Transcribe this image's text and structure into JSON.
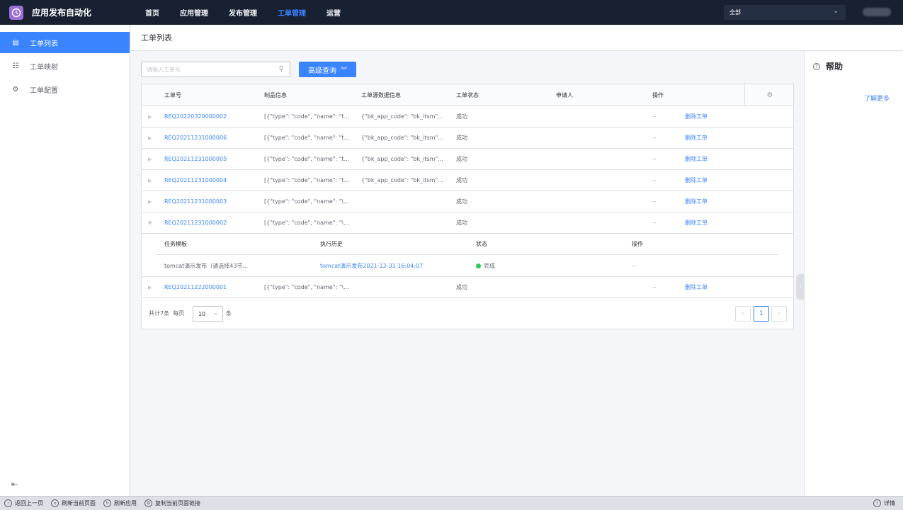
{
  "app": {
    "title": "应用发布自动化",
    "logo_icon": "clock-icon"
  },
  "topnav": {
    "items": [
      {
        "label": "首页",
        "active": false
      },
      {
        "label": "应用管理",
        "active": false
      },
      {
        "label": "发布管理",
        "active": false
      },
      {
        "label": "工单管理",
        "active": true
      },
      {
        "label": "运营",
        "active": false
      }
    ],
    "business_select": "全部"
  },
  "sidebar": {
    "items": [
      {
        "label": "工单列表",
        "icon": "list-icon",
        "active": true
      },
      {
        "label": "工单映射",
        "icon": "grid-icon",
        "active": false
      },
      {
        "label": "工单配置",
        "icon": "gear-icon",
        "active": false
      }
    ]
  },
  "page": {
    "title": "工单列表"
  },
  "search": {
    "placeholder": "请输入工单号",
    "advanced_label": "高级查询"
  },
  "table": {
    "columns": {
      "no": "工单号",
      "product": "制品信息",
      "source": "工单源数据信息",
      "status": "工单状态",
      "applicant": "申请人",
      "ops": "操作"
    },
    "rows": [
      {
        "no": "REQ20220320000002",
        "product": "[{\"type\": \"code\", \"name\": \"t...",
        "source": "{\"bk_app_code\": \"bk_itsm\"...",
        "status": "成功",
        "applicant": "",
        "ops": "--",
        "action": "删除工单"
      },
      {
        "no": "REQ20211231000006",
        "product": "[{\"type\": \"code\", \"name\": \"t...",
        "source": "{\"bk_app_code\": \"bk_itsm\"...",
        "status": "成功",
        "applicant": "",
        "ops": "--",
        "action": "删除工单"
      },
      {
        "no": "REQ20211231000005",
        "product": "[{\"type\": \"code\", \"name\": \"t...",
        "source": "{\"bk_app_code\": \"bk_itsm\"...",
        "status": "成功",
        "applicant": "",
        "ops": "--",
        "action": "删除工单"
      },
      {
        "no": "REQ20211231000004",
        "product": "[{\"type\": \"code\", \"name\": \"t...",
        "source": "{\"bk_app_code\": \"bk_itsm\"...",
        "status": "成功",
        "applicant": "",
        "ops": "--",
        "action": "删除工单"
      },
      {
        "no": "REQ20211231000003",
        "product": "[{\"type\": \"code\", \"name\": \"\\...",
        "source": "",
        "status": "成功",
        "applicant": "",
        "ops": "--",
        "action": "删除工单"
      },
      {
        "no": "REQ20211231000002",
        "product": "[{\"type\": \"code\", \"name\": \"\\...",
        "source": "",
        "status": "成功",
        "applicant": "",
        "ops": "--",
        "action": "删除工单"
      }
    ],
    "expanded": {
      "columns": {
        "template": "任务模板",
        "history": "执行历史",
        "status": "状态",
        "ops": "操作"
      },
      "row": {
        "template": "tomcat演示发布（请选择43节...",
        "history": "tomcat演示发布2021-12-31 16:04:07",
        "status": "完成",
        "status_color": "#2dcb56",
        "ops": "--"
      }
    },
    "last_row": {
      "no": "REQ20211222000001",
      "product": "[{\"type\": \"code\", \"name\": \"\\...",
      "source": "",
      "status": "成功",
      "applicant": "",
      "ops": "--",
      "action": "删除工单"
    }
  },
  "pagination": {
    "total_prefix": "共计",
    "total": "7",
    "total_suffix": "条",
    "per_page_label": "每页",
    "per_page": "10",
    "per_page_unit": "条",
    "current_page": "1"
  },
  "help": {
    "title": "帮助",
    "learn_more": "了解更多"
  },
  "bottombar": {
    "items": [
      {
        "label": "返回上一页",
        "icon": "back-icon"
      },
      {
        "label": "刷新当前页面",
        "icon": "refresh-page-icon"
      },
      {
        "label": "刷新应用",
        "icon": "refresh-app-icon"
      },
      {
        "label": "复制当前页面链接",
        "icon": "copy-link-icon"
      }
    ],
    "details": "详情"
  },
  "colors": {
    "accent": "#3a84ff",
    "nav_bg": "#182132",
    "success": "#2dcb56"
  }
}
